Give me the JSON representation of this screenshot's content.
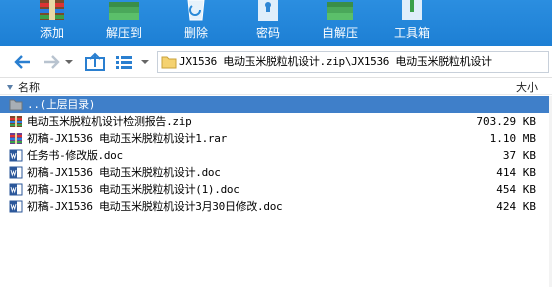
{
  "toolbar": {
    "add_label": "添加",
    "extract_to_label": "解压到",
    "delete_label": "删除",
    "password_label": "密码",
    "sfx_label": "自解压",
    "tools_label": "工具箱"
  },
  "address": {
    "path": "JX1536 电动玉米脱粒机设计.zip\\JX1536 电动玉米脱粒机设计"
  },
  "columns": {
    "name": "名称",
    "size": "大小"
  },
  "files": [
    {
      "name": "..(上层目录)",
      "size": "",
      "icon": "folder-up-icon",
      "selected": true
    },
    {
      "name": "电动玉米脱粒机设计检测报告.zip",
      "size": "703.29 KB",
      "icon": "zip-archive-icon",
      "selected": false
    },
    {
      "name": "初稿-JX1536 电动玉米脱粒机设计1.rar",
      "size": "1.10 MB",
      "icon": "rar-archive-icon",
      "selected": false
    },
    {
      "name": "任务书-修改版.doc",
      "size": "37 KB",
      "icon": "word-doc-icon",
      "selected": false
    },
    {
      "name": "初稿-JX1536 电动玉米脱粒机设计.doc",
      "size": "414 KB",
      "icon": "word-doc-icon",
      "selected": false
    },
    {
      "name": "初稿-JX1536 电动玉米脱粒机设计(1).doc",
      "size": "454 KB",
      "icon": "word-doc-icon",
      "selected": false
    },
    {
      "name": "初稿-JX1536 电动玉米脱粒机设计3月30日修改.doc",
      "size": "424 KB",
      "icon": "word-doc-icon",
      "selected": false
    }
  ],
  "colors": {
    "toolbar_bg": "#1f82d6",
    "selection": "#3f7fc9"
  }
}
